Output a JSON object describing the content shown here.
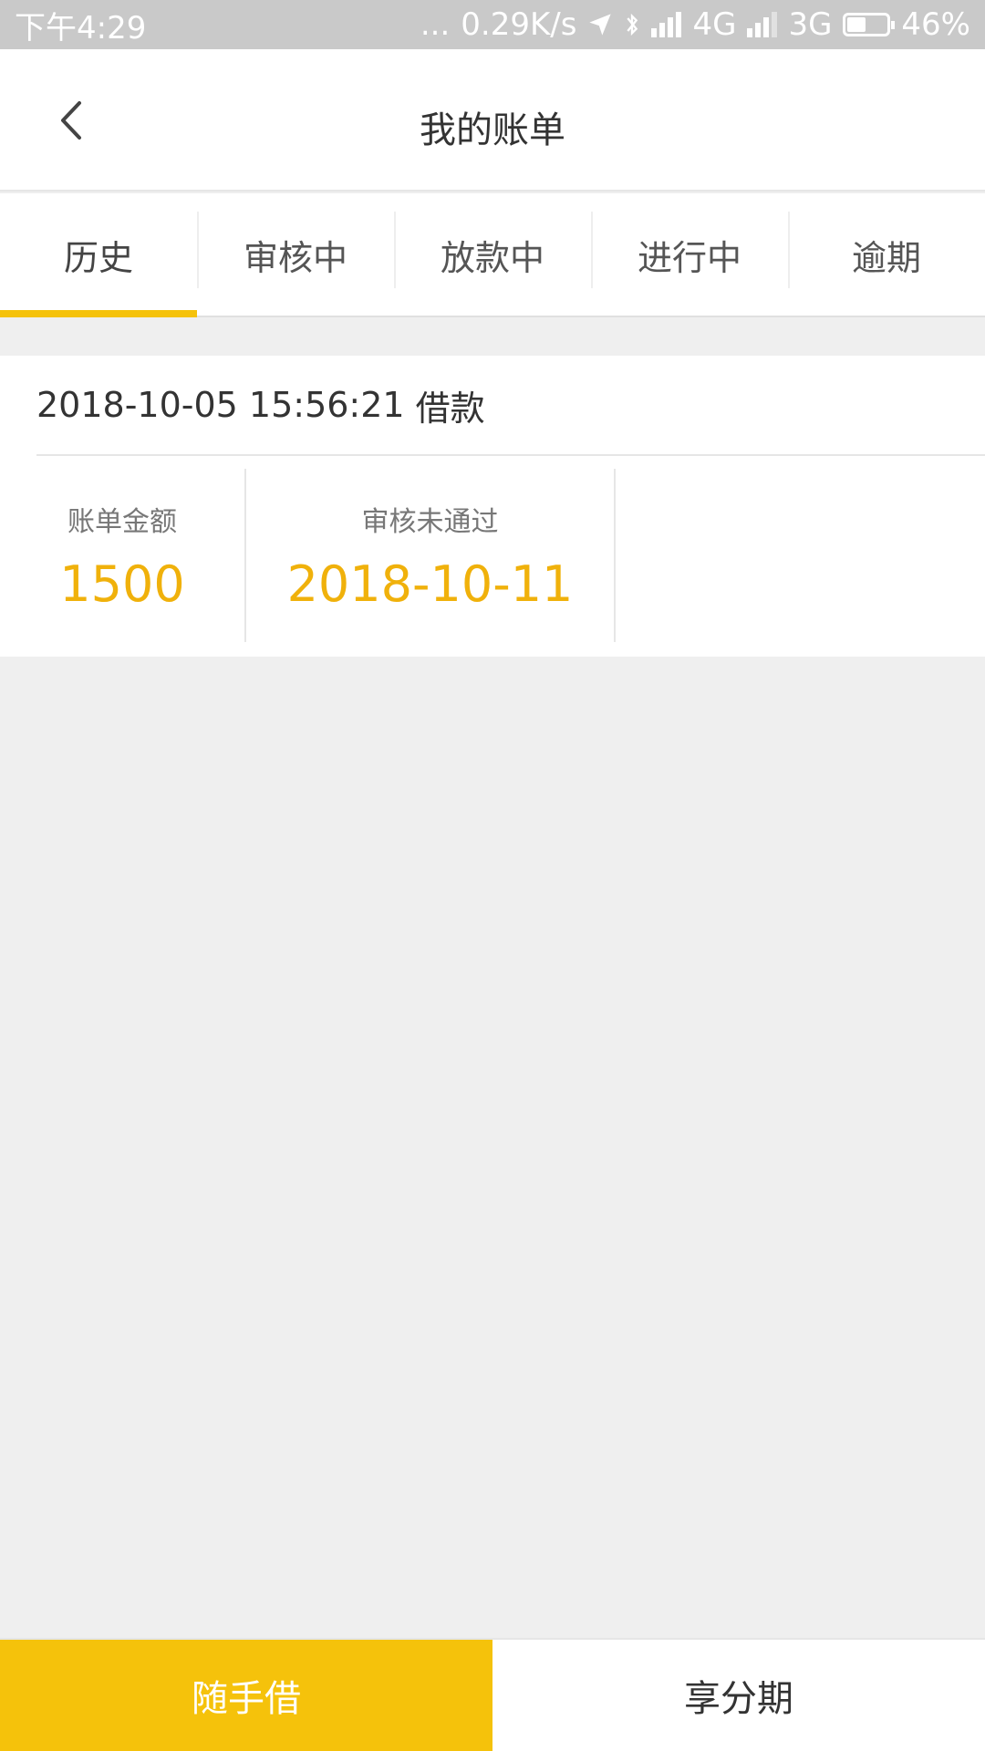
{
  "status_bar": {
    "time": "下午4:29",
    "dots": "...",
    "network_speed": "0.29K/s",
    "network_1": "4G",
    "network_2": "3G",
    "battery": "46%",
    "icons": [
      "location-arrow-icon",
      "bluetooth-icon",
      "signal-icon",
      "battery-icon"
    ]
  },
  "header": {
    "title": "我的账单",
    "back_icon": "chevron-left-icon"
  },
  "tabs": [
    {
      "label": "历史",
      "active": true
    },
    {
      "label": "审核中"
    },
    {
      "label": "放款中"
    },
    {
      "label": "进行中"
    },
    {
      "label": "逾期"
    }
  ],
  "bill": {
    "datetime": "2018-10-05 15:56:21",
    "type": "借款",
    "amount_label": "账单金额",
    "amount": "1500",
    "status_label": "审核未通过",
    "status_date": "2018-10-11"
  },
  "bottom_nav": {
    "left": "随手借",
    "right": "享分期"
  },
  "colors": {
    "accent": "#f5c20b",
    "value_text": "#f0b10b",
    "status_bar": "#c9c9c9",
    "background": "#efefef"
  }
}
